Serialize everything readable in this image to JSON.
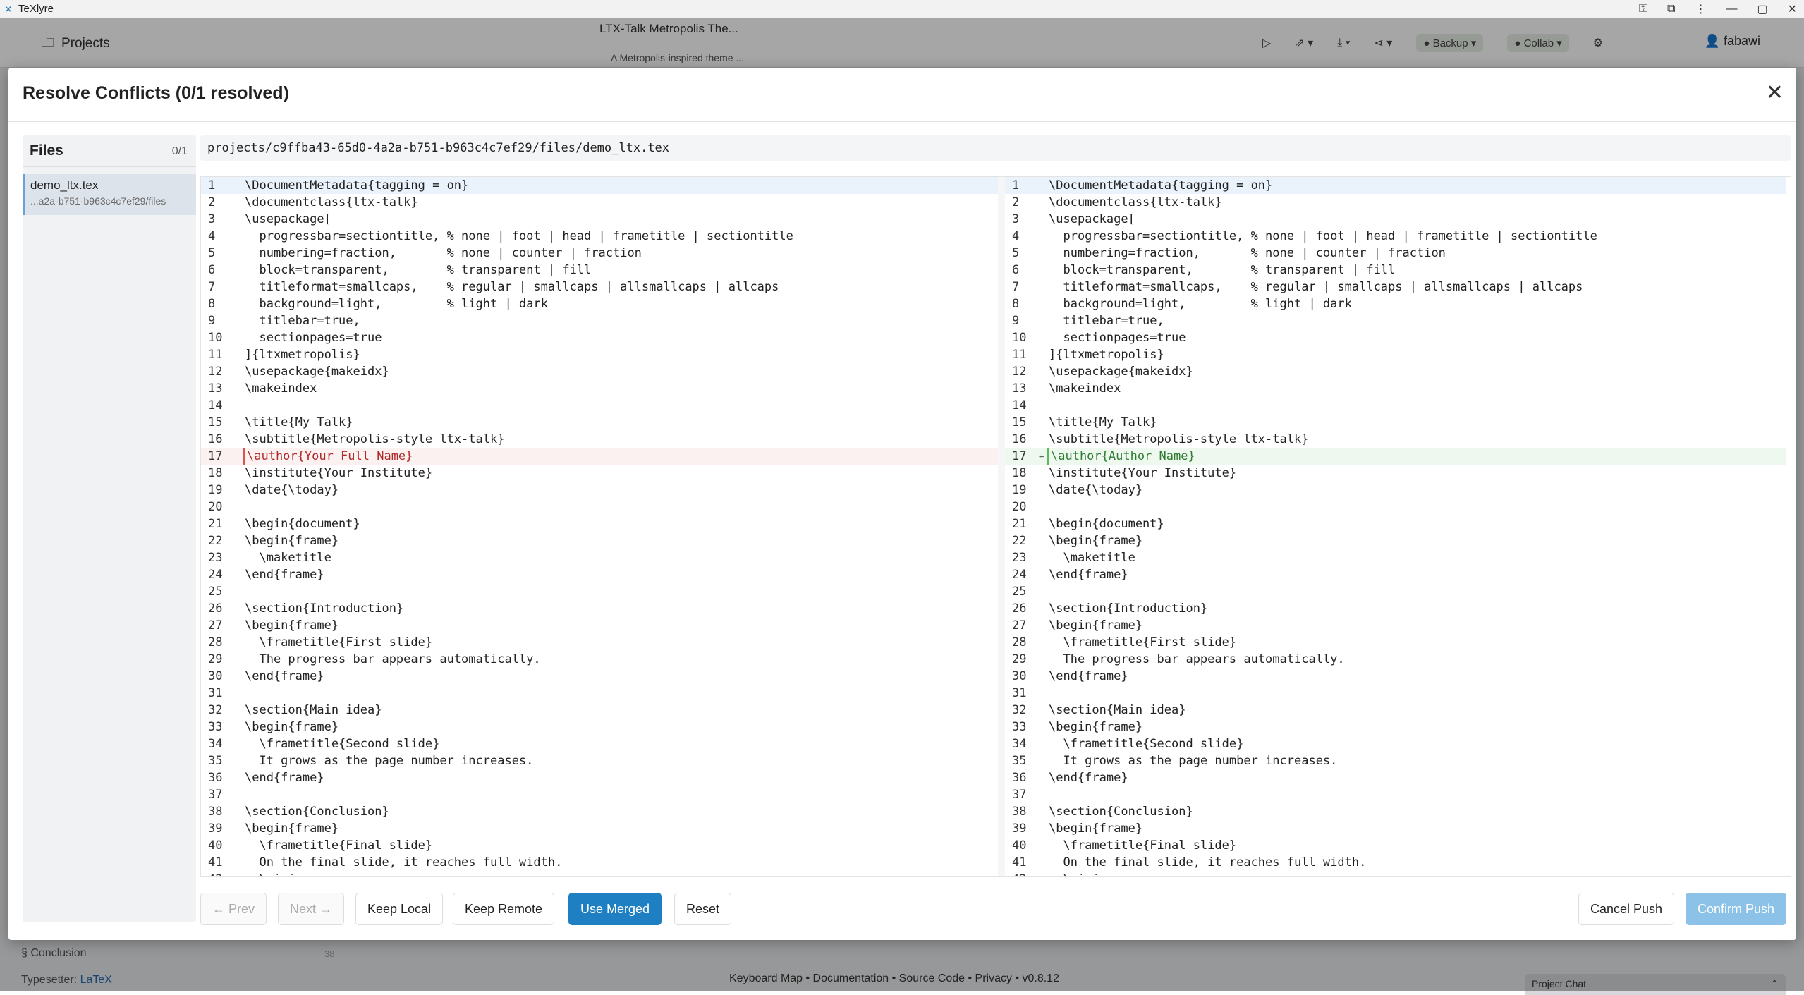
{
  "window": {
    "title": "TeXlyre",
    "controls": [
      "⚿",
      "⧉",
      "⋮",
      "—",
      "▢",
      "✕"
    ]
  },
  "header": {
    "projects_label": "Projects",
    "project_title": "LTX-Talk Metropolis The...",
    "project_subtitle": "A Metropolis-inspired theme ...",
    "backup_label": "Backup",
    "collab_label": "Collab",
    "user_name": "fabawi"
  },
  "footer": {
    "outline_item": "§ Conclusion",
    "outline_line": "38",
    "typesetter_label": "Typesetter:",
    "typesetter_value": "LaTeX",
    "links": "Keyboard Map • Documentation • Source Code • Privacy •  v0.8.12",
    "project_chat": "Project Chat"
  },
  "modal": {
    "title": "Resolve Conflicts (0/1 resolved)",
    "close_icon": "✕",
    "files_header": "Files",
    "files_count": "0/1",
    "file_name": "demo_ltx.tex",
    "file_path": "...a2a-b751-b963c4c7ef29/files",
    "full_path": "projects/c9ffba43-65d0-4a2a-b751-b963c4c7ef29/files/demo_ltx.tex",
    "buttons": {
      "prev": "← Prev",
      "next": "Next →",
      "keep_local": "Keep Local",
      "keep_remote": "Keep Remote",
      "use_merged": "Use Merged",
      "reset": "Reset",
      "cancel_push": "Cancel Push",
      "confirm_push": "Confirm Push"
    }
  },
  "left_lines": [
    "\\DocumentMetadata{tagging = on}",
    "\\documentclass{ltx-talk}",
    "\\usepackage[",
    "  progressbar=sectiontitle, % none | foot | head | frametitle | sectiontitle",
    "  numbering=fraction,       % none | counter | fraction",
    "  block=transparent,        % transparent | fill",
    "  titleformat=smallcaps,    % regular | smallcaps | allsmallcaps | allcaps",
    "  background=light,         % light | dark",
    "  titlebar=true,",
    "  sectionpages=true",
    "]{ltxmetropolis}",
    "\\usepackage{makeidx}",
    "\\makeindex",
    "",
    "\\title{My Talk}",
    "\\subtitle{Metropolis-style ltx-talk}",
    "\\author{Your Full Name}",
    "\\institute{Your Institute}",
    "\\date{\\today}",
    "",
    "\\begin{document}",
    "\\begin{frame}",
    "  \\maketitle",
    "\\end{frame}",
    "",
    "\\section{Introduction}",
    "\\begin{frame}",
    "  \\frametitle{First slide}",
    "  The progress bar appears automatically.",
    "\\end{frame}",
    "",
    "\\section{Main idea}",
    "\\begin{frame}",
    "  \\frametitle{Second slide}",
    "  It grows as the page number increases.",
    "\\end{frame}",
    "",
    "\\section{Conclusion}",
    "\\begin{frame}",
    "  \\frametitle{Final slide}",
    "  On the final slide, it reaches full width.",
    "  \\ninja"
  ],
  "right_lines": [
    "\\DocumentMetadata{tagging = on}",
    "\\documentclass{ltx-talk}",
    "\\usepackage[",
    "  progressbar=sectiontitle, % none | foot | head | frametitle | sectiontitle",
    "  numbering=fraction,       % none | counter | fraction",
    "  block=transparent,        % transparent | fill",
    "  titleformat=smallcaps,    % regular | smallcaps | allsmallcaps | allcaps",
    "  background=light,         % light | dark",
    "  titlebar=true,",
    "  sectionpages=true",
    "]{ltxmetropolis}",
    "\\usepackage{makeidx}",
    "\\makeindex",
    "",
    "\\title{My Talk}",
    "\\subtitle{Metropolis-style ltx-talk}",
    "\\author{Author Name}",
    "\\institute{Your Institute}",
    "\\date{\\today}",
    "",
    "\\begin{document}",
    "\\begin{frame}",
    "  \\maketitle",
    "\\end{frame}",
    "",
    "\\section{Introduction}",
    "\\begin{frame}",
    "  \\frametitle{First slide}",
    "  The progress bar appears automatically.",
    "\\end{frame}",
    "",
    "\\section{Main idea}",
    "\\begin{frame}",
    "  \\frametitle{Second slide}",
    "  It grows as the page number increases.",
    "\\end{frame}",
    "",
    "\\section{Conclusion}",
    "\\begin{frame}",
    "  \\frametitle{Final slide}",
    "  On the final slide, it reaches full width.",
    "  \\ninja"
  ],
  "conflict_line": 17,
  "merge_arrow": "←"
}
